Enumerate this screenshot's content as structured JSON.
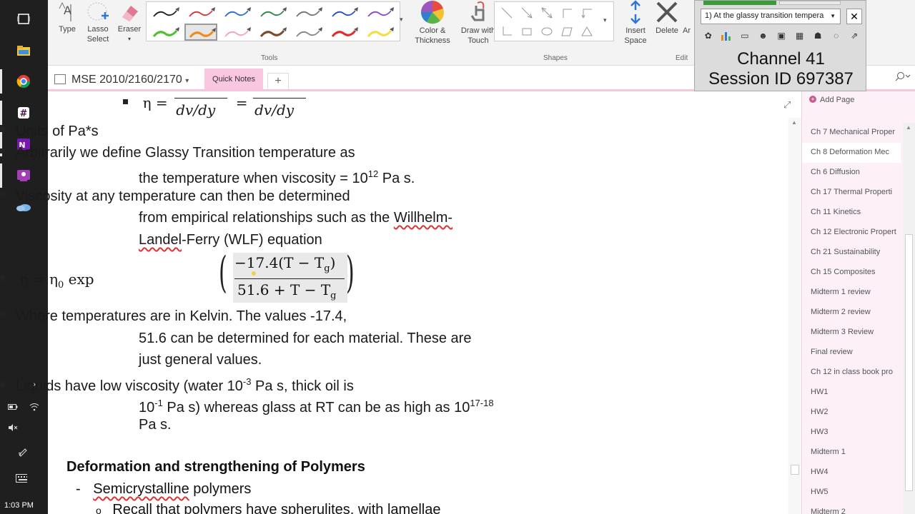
{
  "ribbon": {
    "type_label": "Type",
    "lasso_label": "Lasso Select",
    "eraser_label": "Eraser",
    "tools_group": "Tools",
    "color_label": "Color & Thickness",
    "draw_touch_label": "Draw with Touch",
    "shapes_group": "Shapes",
    "insert_space_label": "Insert Space",
    "delete_label": "Delete",
    "arrange_label": "Ar",
    "edit_group": "Edit",
    "pens": [
      {
        "color": "#222222"
      },
      {
        "color": "#d23b3b"
      },
      {
        "color": "#2f6fd0"
      },
      {
        "color": "#2f8a4a"
      },
      {
        "color": "#777777"
      },
      {
        "color": "#3050c0"
      },
      {
        "color": "#8a4fc6"
      },
      {
        "color": "#4cc22a"
      },
      {
        "color": "#f08a1a"
      },
      {
        "color": "#f2a2c2"
      },
      {
        "color": "#7a4a2a"
      },
      {
        "color": "#888888"
      },
      {
        "color": "#e02c2c"
      },
      {
        "color": "#f2e040"
      }
    ]
  },
  "notebook": {
    "title": "MSE 2010/2160/2170",
    "tab": "Quick Notes",
    "add_tab": "+"
  },
  "overlay": {
    "select_value": "1) At the glassy transition tempera",
    "channel": "Channel 41",
    "session": "Session ID 697387"
  },
  "pages": {
    "add_page": "Add Page",
    "items": [
      "Ch 7 Mechanical Proper",
      "Ch 8 Deformation Mec",
      "Ch 6 Diffusion",
      "Ch 17 Thermal Properti",
      "Ch 11 Kinetics",
      "Ch 12 Electronic Propert",
      "Ch 21 Sustainability",
      "Ch 15 Composites",
      "Midterm 1 review",
      "Midterm 2 review",
      "Midterm 3 Review",
      "Final review",
      "Ch 12 in class book pro",
      "HW1",
      "HW2",
      "HW3",
      "Midterm 1",
      "HW4",
      "HW5",
      "Midterm 2"
    ],
    "selected_index": 1
  },
  "content": {
    "eq1_lhs": "η =",
    "eq1_den1": "dv/dy",
    "eq1_eq": "=",
    "eq1_den2": "dv/dy",
    "units": "Units of Pa*s",
    "glassy_l1": "Arbitrarily we define Glassy Transition temperature as",
    "glassy_l2_a": "the temperature when viscosity = 10",
    "glassy_l2_sup": "12",
    "glassy_l2_b": " Pa s.",
    "visc_l1": "Viscosity at any temperature can then be determined",
    "visc_l2_a": "from empirical relationships such as the ",
    "visc_l2_w": "Willhelm-",
    "visc_l3_w": "Landel",
    "visc_l3_b": "-Ferry (WLF) equation",
    "wlf_lhs": "η = η",
    "wlf_sub": "0",
    "wlf_exp": " exp",
    "wlf_num": "−17.4(T − T",
    "wlf_num_sub": "g",
    "wlf_den": "51.6 + T − T",
    "wlf_den_sub": "g",
    "kelvin_l1": "Where temperatures are in Kelvin. The values -17.4,",
    "kelvin_l2": "51.6 can be determined for each material. These are",
    "kelvin_l3": "just general values.",
    "liq_l1_a": "Liquids have low viscosity (water 10",
    "liq_l1_sup": "-3",
    "liq_l1_b": " Pa s, thick oil is",
    "liq_l2_a": "10",
    "liq_l2_sup": "-1",
    "liq_l2_b": " Pa s) whereas glass at RT can be as high as 10",
    "liq_l2_sup2": "17-18",
    "liq_l3": "Pa s.",
    "heading": "Deformation and strengthening of Polymers",
    "sub_dash": "-",
    "sub_item": "Semicrystalline",
    "sub_item_b": " polymers",
    "subsub_bullet": "o",
    "subsub": "Recall that polymers have spherulites, with lamellae"
  },
  "taskbar": {
    "time": "1:03 PM"
  }
}
